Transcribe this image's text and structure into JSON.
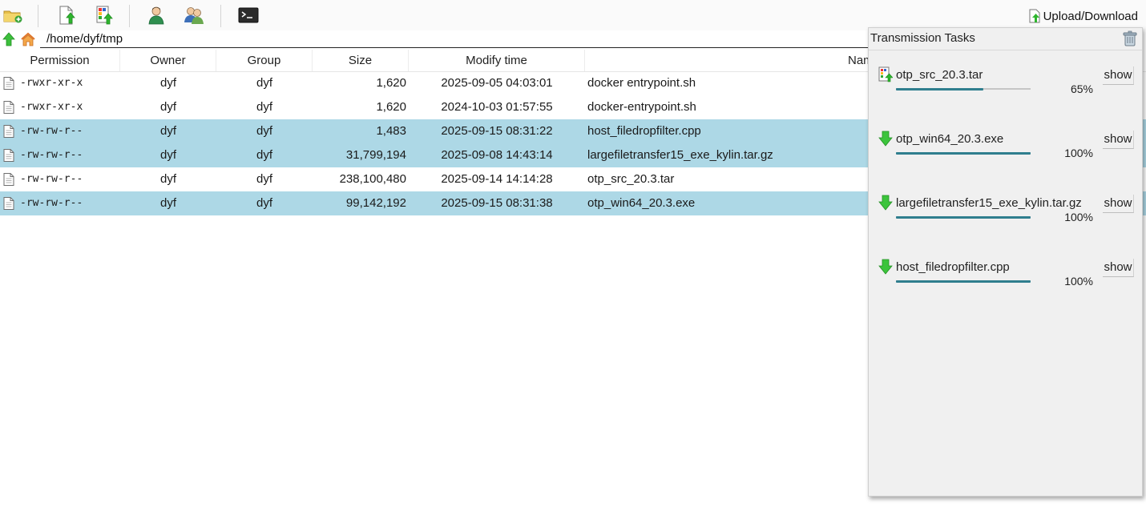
{
  "toolbar": {
    "buttons": [
      "new-folder-icon",
      "upload-file-icon",
      "upload-multiple-icon",
      "user-icon",
      "users-icon",
      "terminal-icon"
    ],
    "upload_download_label": "Upload/Download"
  },
  "pathbar": {
    "path": "/home/dyf/tmp"
  },
  "table": {
    "headers": {
      "permission": "Permission",
      "owner": "Owner",
      "group": "Group",
      "size": "Size",
      "modified": "Modify time",
      "name": "Nam"
    },
    "rows": [
      {
        "permission": "-rwxr-xr-x",
        "owner": "dyf",
        "group": "dyf",
        "size": "1,620",
        "modified": "2025-09-05 04:03:01",
        "name": "docker entrypoint.sh",
        "selected": false
      },
      {
        "permission": "-rwxr-xr-x",
        "owner": "dyf",
        "group": "dyf",
        "size": "1,620",
        "modified": "2024-10-03 01:57:55",
        "name": "docker-entrypoint.sh",
        "selected": false
      },
      {
        "permission": "-rw-rw-r--",
        "owner": "dyf",
        "group": "dyf",
        "size": "1,483",
        "modified": "2025-09-15 08:31:22",
        "name": "host_filedropfilter.cpp",
        "selected": true
      },
      {
        "permission": "-rw-rw-r--",
        "owner": "dyf",
        "group": "dyf",
        "size": "31,799,194",
        "modified": "2025-09-08 14:43:14",
        "name": "largefiletransfer15_exe_kylin.tar.gz",
        "selected": true
      },
      {
        "permission": "-rw-rw-r--",
        "owner": "dyf",
        "group": "dyf",
        "size": "238,100,480",
        "modified": "2025-09-14 14:14:28",
        "name": "otp_src_20.3.tar",
        "selected": false
      },
      {
        "permission": "-rw-rw-r--",
        "owner": "dyf",
        "group": "dyf",
        "size": "99,142,192",
        "modified": "2025-09-15 08:31:38",
        "name": "otp_win64_20.3.exe",
        "selected": true
      }
    ]
  },
  "transmission": {
    "title": "Transmission Tasks",
    "tasks": [
      {
        "name": "otp_src_20.3.tar",
        "direction": "upload",
        "progress": 0.65,
        "percent_label": "65%",
        "show_label": "show"
      },
      {
        "name": "otp_win64_20.3.exe",
        "direction": "download",
        "progress": 1.0,
        "percent_label": "100%",
        "show_label": "show"
      },
      {
        "name": "largefiletransfer15_exe_kylin.tar.gz",
        "direction": "download",
        "progress": 1.0,
        "percent_label": "100%",
        "show_label": "show"
      },
      {
        "name": "host_filedropfilter.cpp",
        "direction": "download",
        "progress": 1.0,
        "percent_label": "100%",
        "show_label": "show"
      }
    ]
  },
  "colors": {
    "selected_row": "#add8e6",
    "progress_fill": "#2f7e8e",
    "panel_bg": "#f0f0f0"
  }
}
